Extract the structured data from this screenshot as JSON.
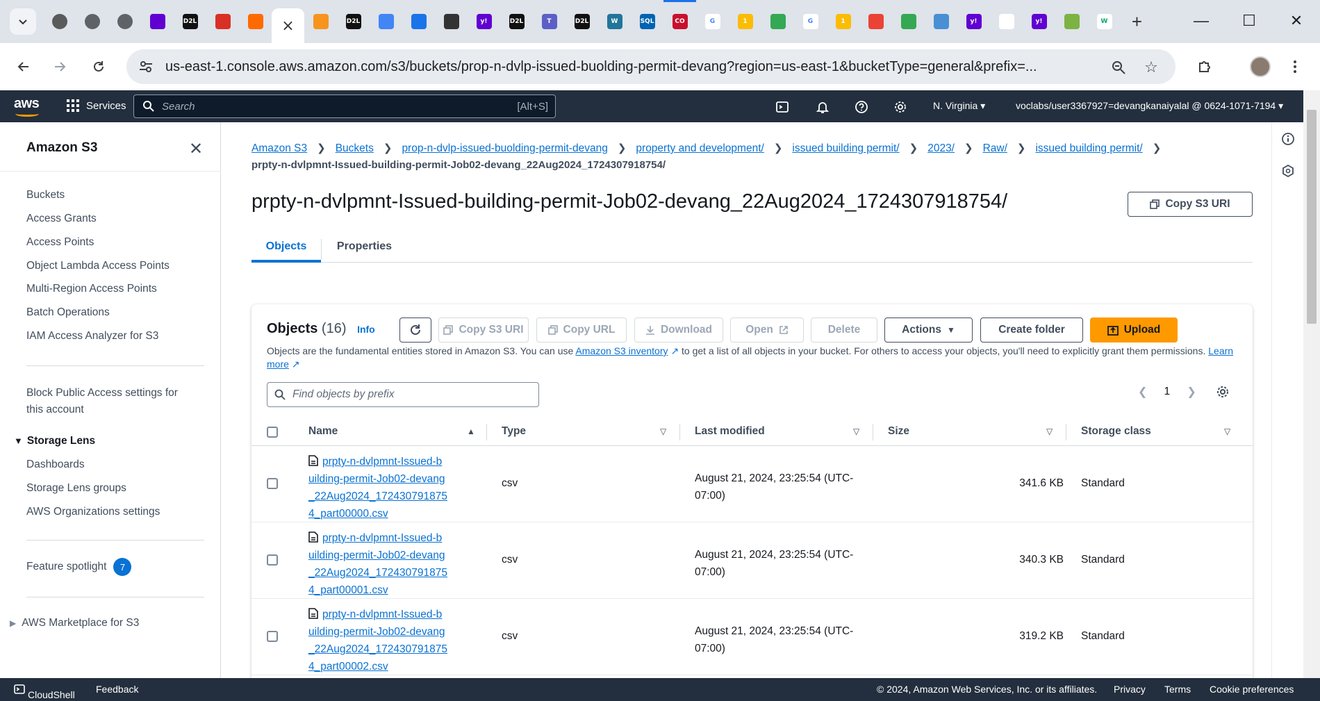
{
  "browser": {
    "tabs": [
      {
        "icon": "yahoo-mail-icon",
        "label": ""
      },
      {
        "icon": "globe-icon",
        "label": ""
      },
      {
        "icon": "globe-icon",
        "label": ""
      },
      {
        "icon": "mail-icon",
        "label": ""
      },
      {
        "icon": "d2l-icon",
        "label": "D2L"
      },
      {
        "icon": "settings-wheel-icon",
        "label": ""
      },
      {
        "icon": "aws-cube-icon",
        "label": ""
      },
      {
        "icon": "close-icon",
        "label": "×"
      },
      {
        "icon": "ubuntu-icon",
        "label": ""
      },
      {
        "icon": "d2l-icon",
        "label": "D2L"
      },
      {
        "icon": "form-icon",
        "label": ""
      },
      {
        "icon": "spiral-icon",
        "label": ""
      },
      {
        "icon": "cloud-icon",
        "label": ""
      },
      {
        "icon": "yahoo-icon",
        "label": "y!"
      },
      {
        "icon": "d2l-icon",
        "label": "D2L"
      },
      {
        "icon": "teams-icon",
        "label": "T"
      },
      {
        "icon": "d2l-icon",
        "label": "D2L"
      },
      {
        "icon": "wordpress-icon",
        "label": "W"
      },
      {
        "icon": "sql-icon",
        "label": "SQL"
      },
      {
        "icon": "co-icon",
        "label": "CO"
      },
      {
        "icon": "google-icon",
        "label": "G"
      },
      {
        "icon": "one-icon",
        "label": "1"
      },
      {
        "icon": "drive-icon",
        "label": ""
      },
      {
        "icon": "google-icon",
        "label": "G"
      },
      {
        "icon": "one-icon",
        "label": "1"
      },
      {
        "icon": "pinwheel-icon",
        "label": ""
      },
      {
        "icon": "drive-icon",
        "label": ""
      },
      {
        "icon": "brain-icon",
        "label": ""
      },
      {
        "icon": "yahoo-icon",
        "label": "y!"
      },
      {
        "icon": "openai-icon",
        "label": ""
      },
      {
        "icon": "yahoo-icon",
        "label": "y!"
      },
      {
        "icon": "leaf-icon",
        "label": ""
      },
      {
        "icon": "w3-icon",
        "label": "W"
      }
    ],
    "url": "us-east-1.console.aws.amazon.com/s3/buckets/prop-n-dvlp-issued-buolding-permit-devang?region=us-east-1&bucketType=general&prefix=..."
  },
  "awsnav": {
    "logo": "aws",
    "services": "Services",
    "search_placeholder": "Search",
    "search_shortcut": "[Alt+S]",
    "region": "N. Virginia",
    "account": "voclabs/user3367927=devangkanaiyalal @ 0624-1071-7194"
  },
  "sidebar": {
    "title": "Amazon S3",
    "items": [
      "Buckets",
      "Access Grants",
      "Access Points",
      "Object Lambda Access Points",
      "Multi-Region Access Points",
      "Batch Operations",
      "IAM Access Analyzer for S3"
    ],
    "block_public_1": "Block Public Access settings for",
    "block_public_2": "this account",
    "storage_lens": "Storage Lens",
    "lens_items": [
      "Dashboards",
      "Storage Lens groups",
      "AWS Organizations settings"
    ],
    "feature_spotlight": "Feature spotlight",
    "feature_badge": "7",
    "marketplace": "AWS Marketplace for S3"
  },
  "breadcrumb": {
    "links": [
      "Amazon S3",
      "Buckets",
      "prop-n-dvlp-issued-buolding-permit-devang",
      "property and development/",
      "issued building permit/",
      "2023/",
      "Raw/",
      "issued building permit/"
    ],
    "current": "prpty-n-dvlpmnt-Issued-building-permit-Job02-devang_22Aug2024_1724307918754/"
  },
  "page": {
    "title": "prpty-n-dvlpmnt-Issued-building-permit-Job02-devang_22Aug2024_1724307918754/",
    "copy_uri": "Copy S3 URI",
    "tabs": [
      "Objects",
      "Properties"
    ]
  },
  "objects": {
    "heading": "Objects",
    "count": "(16)",
    "info": "Info",
    "buttons": {
      "copy_uri": "Copy S3 URI",
      "copy_url": "Copy URL",
      "download": "Download",
      "open": "Open",
      "delete": "Delete",
      "actions": "Actions",
      "create_folder": "Create folder",
      "upload": "Upload"
    },
    "desc_1": "Objects are the fundamental entities stored in Amazon S3. You can use",
    "desc_link": "Amazon S3 inventory",
    "desc_2": "to get a list of all objects in your bucket. For others to access your objects, you'll need to explicitly grant them permissions.",
    "desc_learn": "Learn",
    "desc_more": "more",
    "find_placeholder": "Find objects by prefix",
    "page": "1",
    "columns": [
      "Name",
      "Type",
      "Last modified",
      "Size",
      "Storage class"
    ],
    "rows": [
      {
        "name": "prpty-n-dvlpmnt-Issued-building-permit-Job02-devang_22Aug2024_1724307918754_part00000.csv",
        "type": "csv",
        "modified_1": "August 21, 2024, 23:25:54 (UTC-",
        "modified_2": "07:00)",
        "size": "341.6 KB",
        "storage": "Standard"
      },
      {
        "name": "prpty-n-dvlpmnt-Issued-building-permit-Job02-devang_22Aug2024_1724307918754_part00001.csv",
        "type": "csv",
        "modified_1": "August 21, 2024, 23:25:54 (UTC-",
        "modified_2": "07:00)",
        "size": "340.3 KB",
        "storage": "Standard"
      },
      {
        "name": "prpty-n-dvlpmnt-Issued-building-permit-Job02-devang_22Aug2024_1724307918754_part00002.csv",
        "type": "csv",
        "modified_1": "August 21, 2024, 23:25:54 (UTC-",
        "modified_2": "07:00)",
        "size": "319.2 KB",
        "storage": "Standard"
      }
    ]
  },
  "footer": {
    "cloudshell": "CloudShell",
    "feedback": "Feedback",
    "copyright": "© 2024, Amazon Web Services, Inc. or its affiliates.",
    "privacy": "Privacy",
    "terms": "Terms",
    "cookies": "Cookie preferences"
  }
}
